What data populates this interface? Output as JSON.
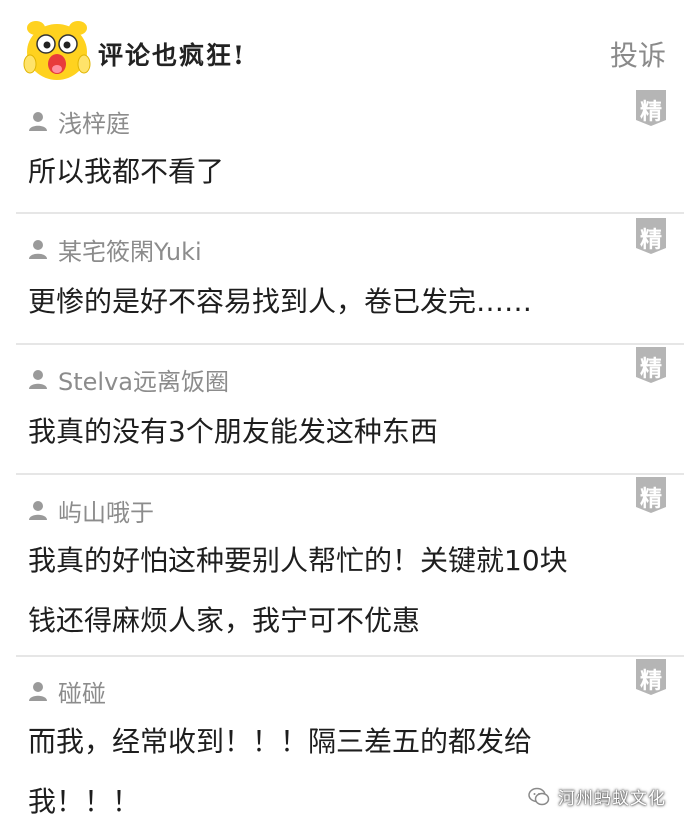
{
  "header": {
    "title": "评论也疯狂!",
    "report_label": "投诉"
  },
  "badge_label": "精",
  "comments": [
    {
      "name": "浅梓庭",
      "lines": [
        "所以我都不看了"
      ]
    },
    {
      "name": "某宅筱閑Yuki",
      "lines": [
        "更惨的是好不容易找到人，卷已发完……"
      ]
    },
    {
      "name": "Stelva远离饭圈",
      "lines": [
        "我真的没有3个朋友能发这种东西"
      ]
    },
    {
      "name": "屿山哦于",
      "lines": [
        "我真的好怕这种要别人帮忙的！关键就10块",
        "钱还得麻烦人家，我宁可不优惠"
      ]
    },
    {
      "name": "碰碰",
      "lines": [
        "而我，经常收到！！！隔三差五的都发给",
        "我！！！"
      ]
    }
  ],
  "watermark": {
    "text": "河州蚂蚁文化"
  },
  "colors": {
    "badge_bg": "#b5b5b5",
    "name_gray": "#8c8c8c",
    "divider": "#e6e6e6"
  }
}
